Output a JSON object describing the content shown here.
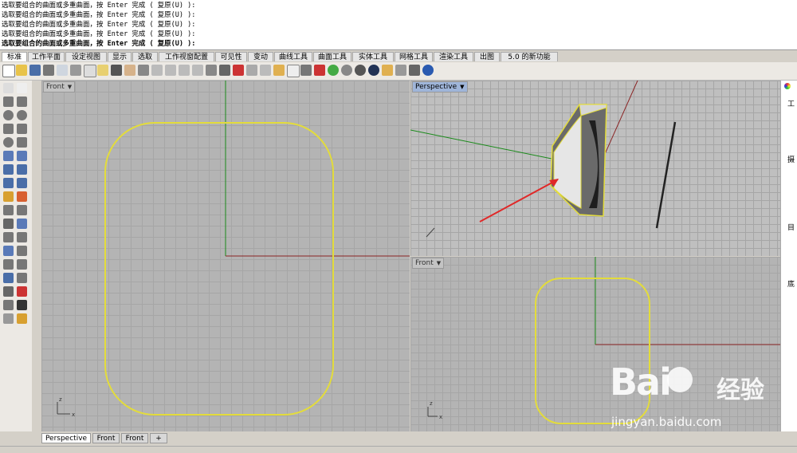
{
  "command_history": [
    "选取要组合的曲面或多重曲面，按 Enter 完成 ( 复原(U) ):",
    "选取要组合的曲面或多重曲面，按 Enter 完成 ( 复原(U) ):",
    "选取要组合的曲面或多重曲面，按 Enter 完成 ( 复原(U) ):",
    "选取要组合的曲面或多重曲面，按 Enter 完成 ( 复原(U) ):"
  ],
  "command_prompt": "选取要组合的曲面或多重曲面，按 Enter 完成 ( 复原(U) ):",
  "tabs": [
    "标准",
    "工作平面",
    "设定视图",
    "显示",
    "选取",
    "工作视窗配置",
    "可见性",
    "变动",
    "曲线工具",
    "曲面工具",
    "实体工具",
    "网格工具",
    "渲染工具",
    "出图",
    "5.0 的新功能"
  ],
  "viewports": {
    "front_main": "Front",
    "perspective": "Perspective",
    "front_small": "Front"
  },
  "axis": {
    "x": "x",
    "y": "z"
  },
  "bottom_tabs": [
    "Perspective",
    "Front",
    "Front",
    "+"
  ],
  "right_panel": [
    "工",
    "摄",
    "目",
    "底"
  ],
  "watermark": {
    "brand": "Bai",
    "cn": "经验",
    "url": "jingyan.baidu.com"
  },
  "colors": {
    "curve": "#e3dc3b",
    "x_axis": "#8a2323",
    "z_axis": "#1a8a1a",
    "arrow": "#e02828",
    "active_label": "#9fb5d9"
  }
}
